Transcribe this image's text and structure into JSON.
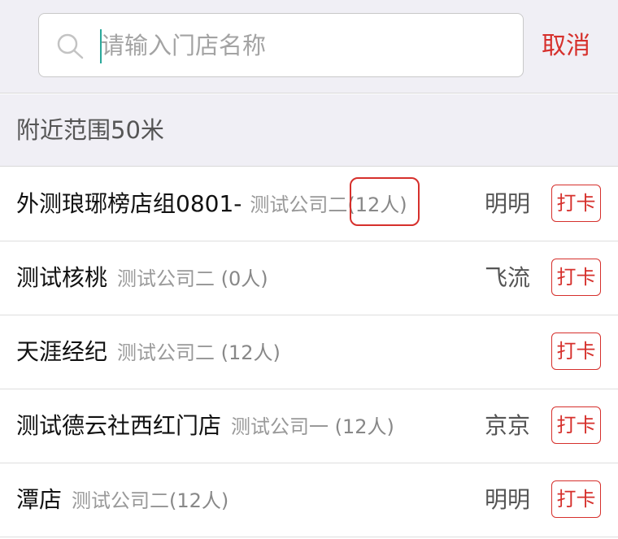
{
  "search": {
    "placeholder": "请输入门店名称",
    "value": "",
    "cancel_label": "取消"
  },
  "section": {
    "title": "附近范围50米"
  },
  "stores": [
    {
      "name": "外测琅琊榜店组0801-",
      "company": "测试公司二",
      "count": "(12人)",
      "manager": "明明",
      "checkin_label": "打卡",
      "count_highlighted": true
    },
    {
      "name": "测试核桃",
      "company": "测试公司二",
      "count": " (0人)",
      "manager": "飞流",
      "checkin_label": "打卡",
      "count_highlighted": false
    },
    {
      "name": "天涯经纪",
      "company": "测试公司二",
      "count": " (12人)",
      "manager": "",
      "checkin_label": "打卡",
      "count_highlighted": false
    },
    {
      "name": "测试德云社西红门店",
      "company": "测试公司一",
      "count": " (12人)",
      "manager": "京京",
      "checkin_label": "打卡",
      "count_highlighted": false
    },
    {
      "name": "潭店",
      "company": "测试公司二",
      "count": "(12人)",
      "manager": "明明",
      "checkin_label": "打卡",
      "count_highlighted": false
    }
  ],
  "colors": {
    "accent": "#d6302c",
    "background": "#f0eff5",
    "caret": "#2aa89a"
  }
}
